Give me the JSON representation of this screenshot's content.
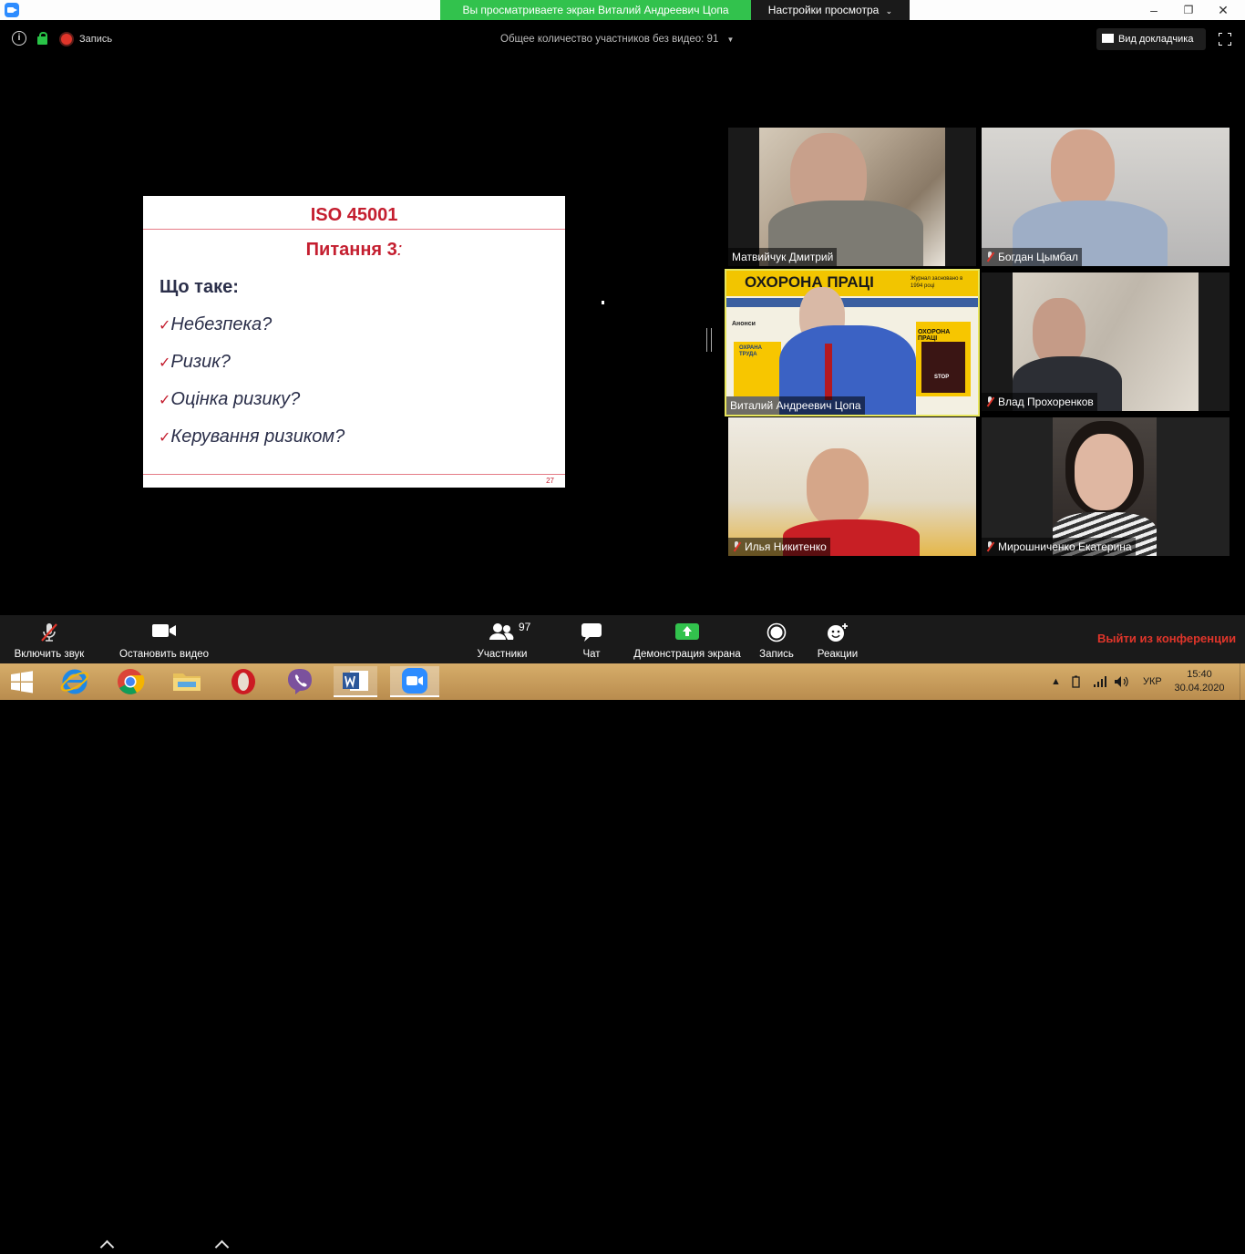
{
  "window": {
    "share_banner": "Вы просматриваете экран Виталий Андреевич Цопа",
    "view_options": "Настройки просмотра",
    "controls": [
      "–",
      "❐",
      "✕"
    ]
  },
  "top": {
    "recording": "Запись",
    "no_video_count": "Общее количество участников без видео: 91",
    "speaker_view": "Вид докладчика"
  },
  "slide": {
    "title": "ISO 45001",
    "subtitle": "Питання 3",
    "subtitle_suffix": ":",
    "question": "Що таке:",
    "items": [
      "Небезпека?",
      "Ризик?",
      "Оцінка ризику?",
      "Керування ризиком?"
    ],
    "page_number": "27"
  },
  "participants": [
    {
      "name": "Матвийчук Дмитрий",
      "muted": false
    },
    {
      "name": "Богдан Цымбал",
      "muted": true
    },
    {
      "name": "Виталий Андреевич Цопа",
      "muted": false,
      "active": true,
      "screen_text": {
        "banner": "ОХОРОНА ПРАЦІ",
        "note": "Журнал засновано в 1994 році",
        "side_label": "Анонси",
        "mag1": "ОХРАНА ТРУДА",
        "mag2": "ОХОРОНА ПРАЦІ",
        "stop": "STOP"
      }
    },
    {
      "name": "Влад Прохоренков",
      "muted": true
    },
    {
      "name": "Илья Никитенко",
      "muted": true
    },
    {
      "name": "Мирошниченко Екатерина",
      "muted": true
    }
  ],
  "toolbar": {
    "unmute": "Включить звук",
    "stop_video": "Остановить видео",
    "participants": "Участники",
    "participants_count": "97",
    "chat": "Чат",
    "share_screen": "Демонстрация экрана",
    "record": "Запись",
    "reactions": "Реакции",
    "leave": "Выйти из конференции"
  },
  "taskbar": {
    "apps": [
      "start-icon",
      "ie-icon",
      "chrome-icon",
      "explorer-icon",
      "opera-icon",
      "viber-icon",
      "word-icon",
      "zoom-icon"
    ],
    "language": "УКР",
    "time": "15:40",
    "date": "30.04.2020"
  },
  "colors": {
    "banner_green": "#32c24d",
    "accent_red": "#c41e2f",
    "leave_red": "#e0352a",
    "active_border": "#e8e65d",
    "zoom_blue": "#2d8cff"
  }
}
